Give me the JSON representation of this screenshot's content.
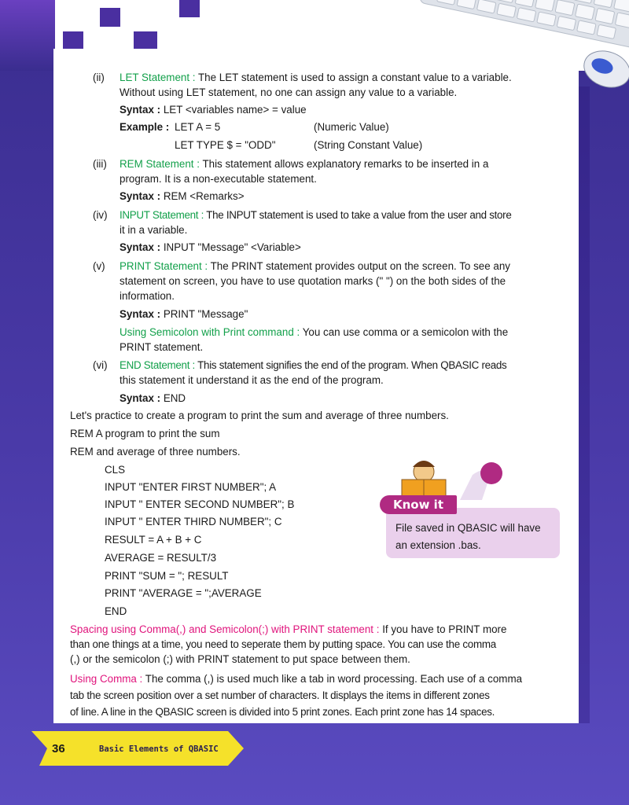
{
  "statements": [
    {
      "num": "(ii)",
      "heading": "LET Statement :",
      "lines": [
        "The LET statement is used to assign a constant value to a variable.",
        "Without using LET statement, no one can assign any value to a variable."
      ],
      "syntax_label": "Syntax :",
      "syntax": "LET <variables name> = value",
      "example_label": "Example :",
      "examples": [
        {
          "code": "LET A = 5",
          "note": "(Numeric Value)"
        },
        {
          "code": "LET TYPE $ = \"ODD\"",
          "note": "(String Constant Value)"
        }
      ]
    },
    {
      "num": "(iii)",
      "heading": "REM Statement :",
      "lines": [
        "This statement allows explanatory remarks to be inserted in a",
        "program. It is a non-executable statement."
      ],
      "syntax_label": "Syntax :",
      "syntax": "REM <Remarks>"
    },
    {
      "num": "(iv)",
      "heading": "INPUT Statement :",
      "lines": [
        "The INPUT statement is used to take a value from the user and store",
        "it in a variable."
      ],
      "syntax_label": "Syntax :",
      "syntax": "INPUT \"Message\" <Variable>"
    },
    {
      "num": "(v)",
      "heading": "PRINT Statement :",
      "lines": [
        "The PRINT statement provides output on the screen. To see any",
        "statement on screen, you have to use quotation marks (\" \") on the both sides of the",
        "information."
      ],
      "syntax_label": "Syntax :",
      "syntax": "PRINT \"Message\"",
      "sub_heading": "Using Semicolon with Print command :",
      "sub_lines": [
        "You can use comma or a semicolon with the",
        "PRINT statement."
      ]
    },
    {
      "num": "(vi)",
      "heading": "END Statement :",
      "lines": [
        "This statement signifies the end of the program. When QBASIC reads",
        "this statement it understand it as the end of the program."
      ],
      "syntax_label": "Syntax :",
      "syntax": "END"
    }
  ],
  "practice": {
    "intro": "Let's practice to create a program to print the sum and average of three numbers.",
    "rem1": "REM A program to print the sum",
    "rem2": "REM and average of three numbers.",
    "code": [
      "CLS",
      "INPUT \"ENTER FIRST NUMBER\"; A",
      "INPUT \" ENTER SECOND NUMBER\"; B",
      "INPUT \" ENTER THIRD NUMBER\"; C",
      "RESULT = A + B + C",
      "AVERAGE = RESULT/3",
      "PRINT \"SUM = \"; RESULT",
      "PRINT \"AVERAGE = \";AVERAGE",
      "END"
    ]
  },
  "spacing": {
    "heading": "Spacing using Comma(,) and Semicolon(;) with PRINT statement :",
    "lines": [
      "If you have to PRINT more",
      "than one things at a time, you need to seperate them by putting space. You can use the comma",
      "(,) or the semicolon (;) with PRINT statement to put space between them."
    ]
  },
  "comma": {
    "heading": "Using Comma :",
    "lines": [
      "The comma (,) is used much like a tab in word processing. Each use of a comma",
      "tab the screen position over a set number of characters. It displays the items in different zones",
      "of line. A line in the QBASIC screen is divided into 5 print zones. Each print zone has 14 spaces."
    ]
  },
  "know_it": {
    "label": "Know it",
    "lines": [
      "File saved in QBASIC will have",
      "an extension .bas."
    ]
  },
  "footer": {
    "page_number": "36",
    "chapter": "Basic Elements of QBASIC"
  },
  "colors": {
    "heading_green": "#12a04a",
    "heading_magenta": "#e0147c",
    "background_purple": "#3a2d8f",
    "knowit_pink": "#ead0ec",
    "knowit_tab": "#b02a82",
    "footer_yellow": "#f5e12a"
  }
}
